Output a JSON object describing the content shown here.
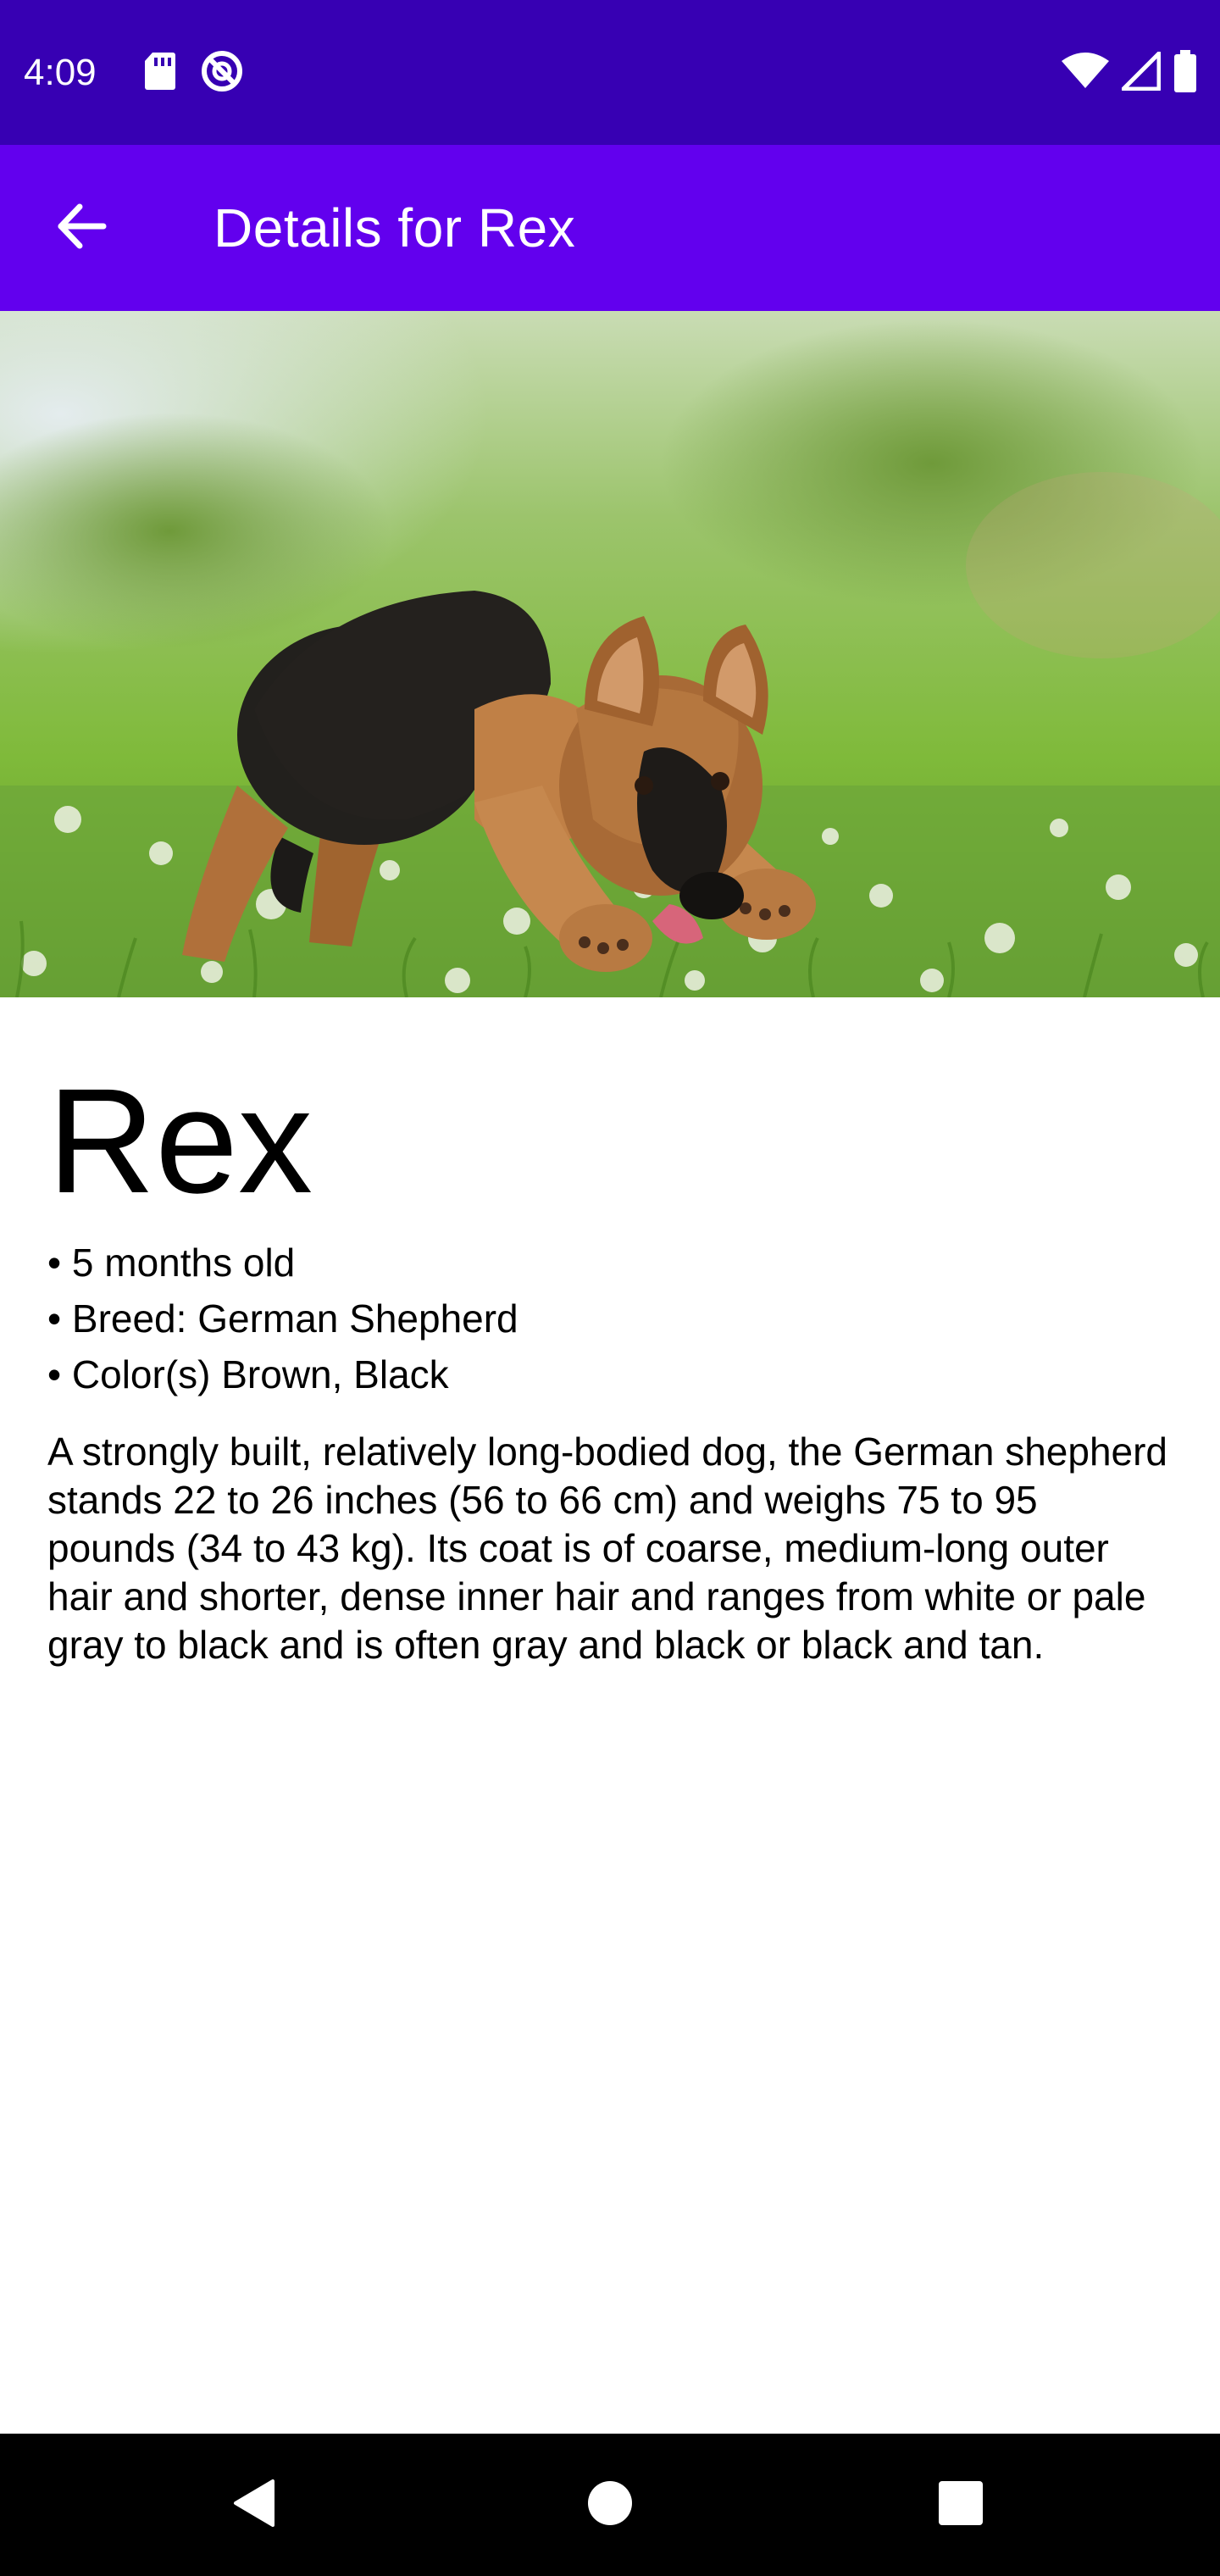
{
  "status_bar": {
    "time": "4:09",
    "left_icons": [
      "sd-card-icon",
      "do-not-disturb-icon"
    ],
    "right_icons": [
      "wifi-icon",
      "signal-icon",
      "battery-icon"
    ]
  },
  "app_bar": {
    "back_icon": "arrow-back-icon",
    "title": "Details for Rex"
  },
  "pet": {
    "name": "Rex",
    "facts": [
      "5 months old",
      "Breed: German Shepherd",
      "Color(s) Brown, Black"
    ],
    "description": "A strongly built, relatively long-bodied dog, the German shepherd stands 22 to 26 inches (56 to 66 cm) and weighs 75 to 95 pounds (34 to 43 kg). Its coat is of coarse, medium-long outer hair and shorter, dense inner hair and ranges from white or pale gray to black and is often gray and black or black and tan."
  },
  "nav_bar": {
    "buttons": [
      "back-triangle-icon",
      "home-circle-icon",
      "recents-square-icon"
    ]
  },
  "colors": {
    "status_bar": "#3700b3",
    "app_bar": "#6200ee",
    "nav_bar": "#000000"
  }
}
